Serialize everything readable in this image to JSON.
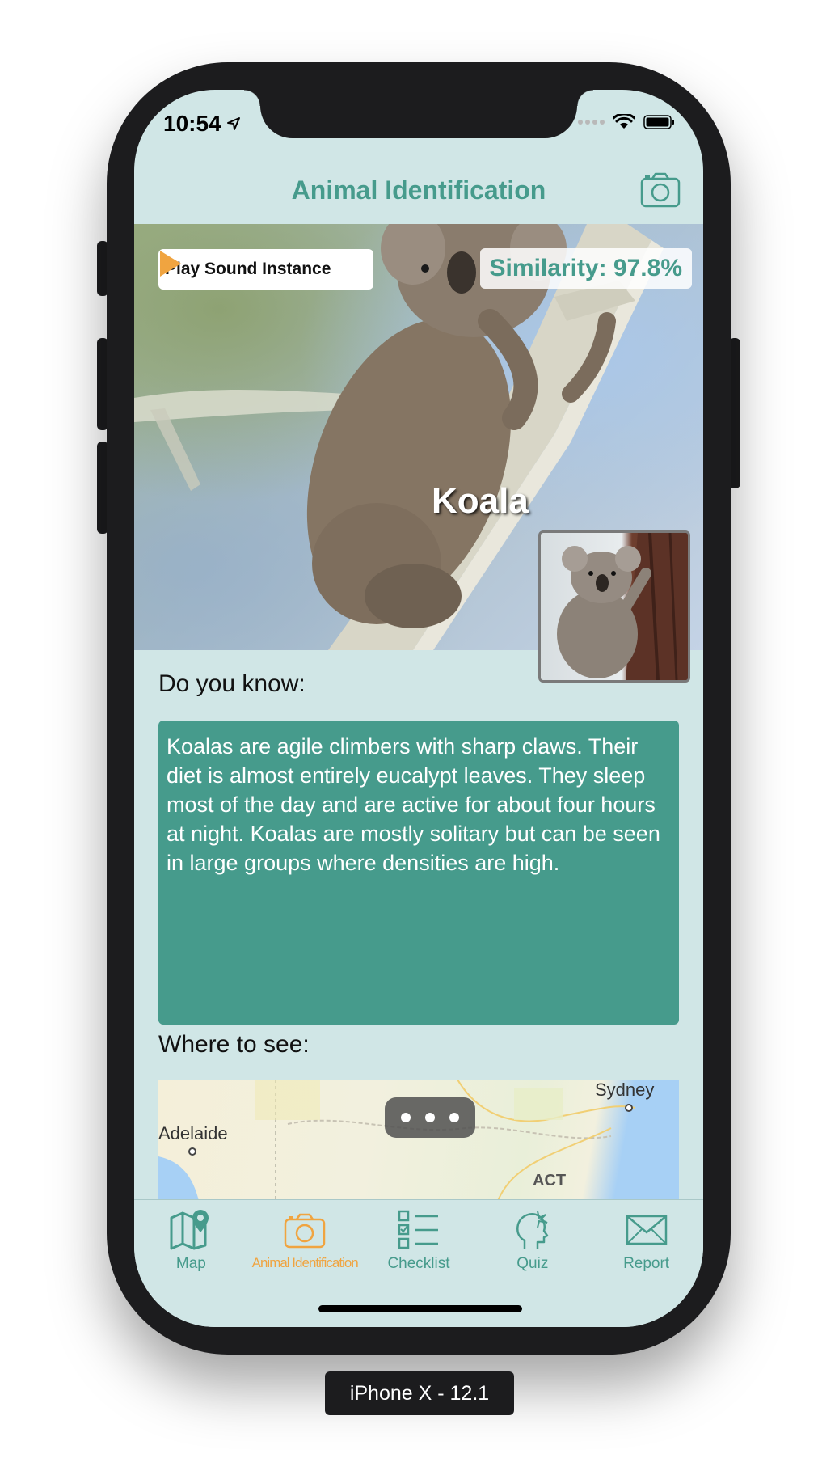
{
  "status_bar": {
    "time": "10:54"
  },
  "nav": {
    "title": "Animal Identification",
    "camera_icon": "camera-icon"
  },
  "hero": {
    "play_button_label": "Play Sound Instance",
    "similarity": "Similarity: 97.8%",
    "animal_name": "Koala"
  },
  "content": {
    "do_you_know_label": "Do you know:",
    "fact_text": "Koalas are agile climbers with sharp claws. Their diet is almost entirely eucalypt leaves. They sleep most of the day and are active for about four hours at night. Koalas are mostly solitary but can be seen in large groups where densities are high.",
    "where_to_see_label": "Where to see:"
  },
  "map": {
    "labels": {
      "sydney": "Sydney",
      "adelaide": "Adelaide",
      "act": "ACT"
    }
  },
  "tabbar": {
    "tabs": [
      {
        "label": "Map",
        "icon": "map-pin-icon",
        "active": false
      },
      {
        "label": "Animal Identification",
        "icon": "camera-icon",
        "active": true
      },
      {
        "label": "Checklist",
        "icon": "checklist-icon",
        "active": false
      },
      {
        "label": "Quiz",
        "icon": "brain-head-icon",
        "active": false
      },
      {
        "label": "Report",
        "icon": "envelope-icon",
        "active": false
      }
    ]
  },
  "device_caption": "iPhone X - 12.1",
  "colors": {
    "accent": "#469b8c",
    "active_tab": "#f0a440",
    "background": "#d0e6e6"
  }
}
